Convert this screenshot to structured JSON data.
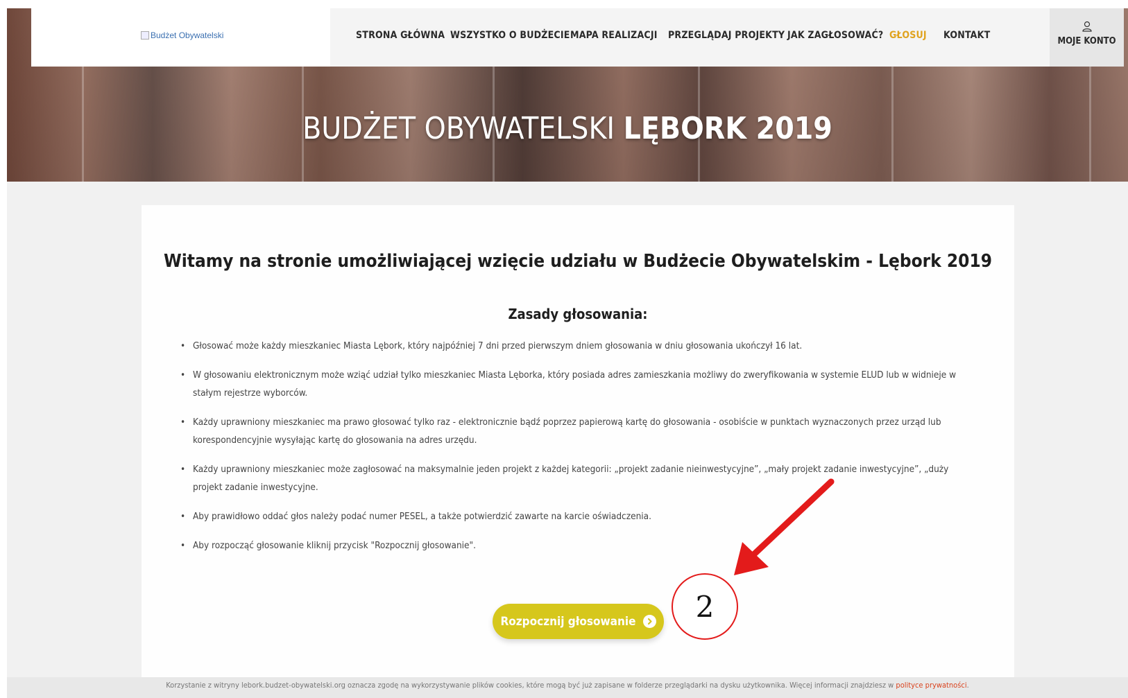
{
  "header": {
    "logo_alt": "Budżet Obywatelski",
    "nav": [
      {
        "label": "STRONA GŁÓWNA",
        "active": false
      },
      {
        "label": "WSZYSTKO O BUDŻECIE",
        "active": false
      },
      {
        "label": "MAPA REALIZACJI",
        "active": false
      },
      {
        "label": "PRZEGLĄDAJ PROJEKTY",
        "active": false
      },
      {
        "label": "JAK ZAGŁOSOWAĆ?",
        "active": false
      },
      {
        "label": "GŁOSUJ",
        "active": true
      },
      {
        "label": "KONTAKT",
        "active": false
      }
    ],
    "account_label": "MOJE KONTO",
    "account_icon": "user-icon"
  },
  "hero": {
    "title_regular": "BUDŻET OBYWATELSKI",
    "title_bold": "LĘBORK 2019"
  },
  "main": {
    "welcome_title": "Witamy na stronie umożliwiającej wzięcie udziału w Budżecie Obywatelskim - Lębork 2019",
    "rules_title": "Zasady głosowania:",
    "rules": [
      "Głosować może każdy mieszkaniec Miasta Lębork, który najpóźniej 7 dni przed pierwszym dniem głosowania w dniu głosowania ukończył 16 lat.",
      "W głosowaniu elektronicznym może wziąć udział tylko mieszkaniec Miasta Lęborka, który posiada adres zamieszkania możliwy do zweryfikowania w systemie ELUD lub w widnieje w stałym rejestrze wyborców.",
      "Każdy uprawniony mieszkaniec ma prawo głosować tylko raz - elektronicznie bądź poprzez papierową kartę do głosowania - osobiście w punktach wyznaczonych przez urząd lub korespondencyjnie wysyłając kartę do głosowania na adres urzędu.",
      "Każdy uprawniony mieszkaniec może zagłosować na maksymalnie jeden projekt z każdej kategorii: „projekt zadanie nieinwestycyjne”, „mały projekt zadanie inwestycyjne”, „duży projekt zadanie inwestycyjne.",
      "Aby prawidłowo oddać głos należy podać numer PESEL, a także potwierdzić zawarte na karcie oświadczenia.",
      "Aby rozpocząć głosowanie kliknij przycisk \"Rozpocznij głosowanie\"."
    ],
    "start_button_label": "Rozpocznij głosowanie",
    "start_button_icon": "chevron-circle-right-icon"
  },
  "annotation": {
    "step_number": "2",
    "color": "#e31b1b"
  },
  "cookie_bar": {
    "text": "Korzystanie z witryny lebork.budzet-obywatelski.org oznacza zgodę na wykorzystywanie plików cookies, które mogą być już zapisane w folderze przeglądarki na dysku użytkownika. Więcej informacji znajdziesz w ",
    "link_text": "polityce prywatności",
    "suffix": "."
  },
  "colors": {
    "accent_active_nav": "#e0a31f",
    "button_bg": "#d6c71c",
    "policy_link": "#d9431e"
  }
}
